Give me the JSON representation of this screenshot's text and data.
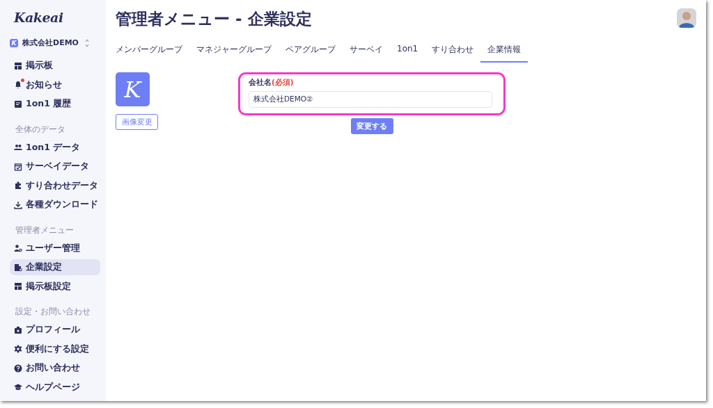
{
  "sidebar": {
    "logo": "Kakeai",
    "company": {
      "initial": "K",
      "name": "株式会社DEMO"
    },
    "sections": [
      {
        "items": [
          {
            "label": "掲示板",
            "selected": false,
            "badge": false
          },
          {
            "label": "お知らせ",
            "selected": false,
            "badge": true
          },
          {
            "label": "1on1 履歴",
            "selected": false,
            "badge": false
          }
        ]
      },
      {
        "heading": "全体のデータ",
        "items": [
          {
            "label": "1on1 データ",
            "selected": false,
            "badge": false
          },
          {
            "label": "サーベイデータ",
            "selected": false,
            "badge": false
          },
          {
            "label": "すり合わせデータ",
            "selected": false,
            "badge": false
          },
          {
            "label": "各種ダウンロード",
            "selected": false,
            "badge": false
          }
        ]
      },
      {
        "heading": "管理者メニュー",
        "items": [
          {
            "label": "ユーザー管理",
            "selected": false,
            "badge": false
          },
          {
            "label": "企業設定",
            "selected": true,
            "badge": false
          },
          {
            "label": "掲示板設定",
            "selected": false,
            "badge": false
          }
        ]
      },
      {
        "heading": "設定・お問い合わせ",
        "items": [
          {
            "label": "プロフィール",
            "selected": false,
            "badge": false
          },
          {
            "label": "便利にする設定",
            "selected": false,
            "badge": false
          },
          {
            "label": "お問い合わせ",
            "selected": false,
            "badge": false
          },
          {
            "label": "ヘルプページ",
            "selected": false,
            "badge": false
          }
        ]
      }
    ]
  },
  "title": "管理者メニュー - 企業設定",
  "tabs": [
    {
      "label": "メンバーグループ",
      "selected": false
    },
    {
      "label": "マネジャーグループ",
      "selected": false
    },
    {
      "label": "ペアグループ",
      "selected": false
    },
    {
      "label": "サーベイ",
      "selected": false
    },
    {
      "label": "1on1",
      "selected": false
    },
    {
      "label": "すり合わせ",
      "selected": false
    },
    {
      "label": "企業情報",
      "selected": true
    }
  ],
  "logo_image": {
    "letter": "K",
    "button": "画像変更"
  },
  "form": {
    "label": "会社名",
    "required": "(必須)",
    "value": "株式会社DEMO②",
    "highlighted": true,
    "submit": "変更する"
  }
}
